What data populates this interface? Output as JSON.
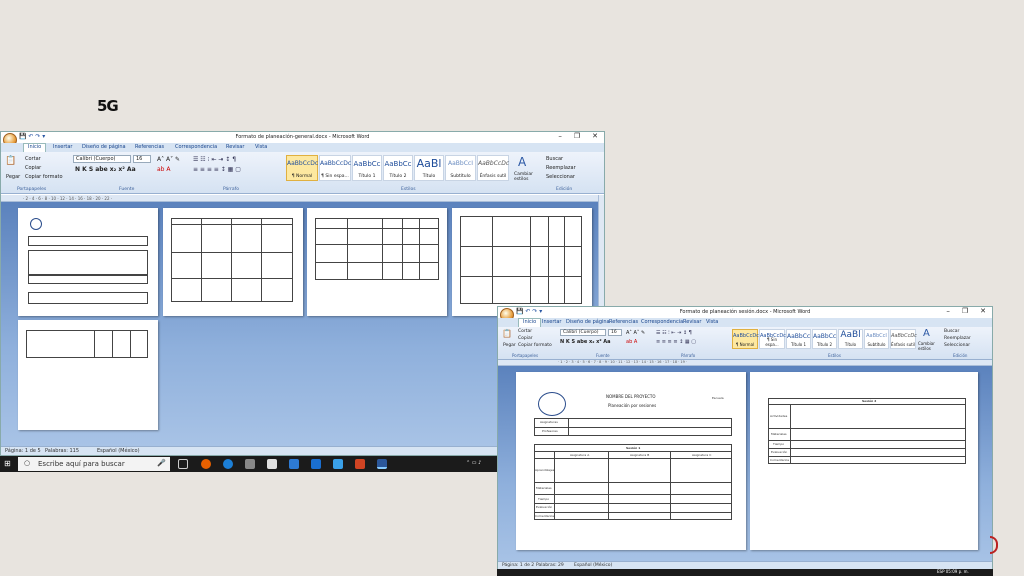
{
  "slide": {
    "title": "5G"
  },
  "window1": {
    "title": "Formato de planeación-general.docx - Microsoft Word",
    "tabs": [
      "Inicio",
      "Insertar",
      "Diseño de página",
      "Referencias",
      "Correspondencia",
      "Revisar",
      "Vista"
    ],
    "clipboard": {
      "paste": "Pegar",
      "cut": "Cortar",
      "copy": "Copiar",
      "format_painter": "Copiar formato",
      "group": "Portapapeles"
    },
    "font": {
      "name": "Calibri (Cuerpo)",
      "size": "16",
      "group": "Fuente"
    },
    "paragraph_group": "Párrafo",
    "styles": [
      {
        "sample": "AaBbCcDc",
        "name": "¶ Normal"
      },
      {
        "sample": "AaBbCcDc",
        "name": "¶ Sin espa..."
      },
      {
        "sample": "AaBbCc",
        "name": "Título 1"
      },
      {
        "sample": "AaBbCc",
        "name": "Título 2"
      },
      {
        "sample": "AaBl",
        "name": "Título"
      },
      {
        "sample": "AaBbCcI",
        "name": "Subtítulo"
      },
      {
        "sample": "AaBbCcDc",
        "name": "Énfasis sutil"
      }
    ],
    "styles_group": "Estilos",
    "change_styles": "Cambiar estilos",
    "editing": {
      "find": "Buscar",
      "replace": "Reemplazar",
      "select": "Seleccionar",
      "group": "Edición"
    },
    "status": {
      "page": "Página: 1 de 5",
      "words": "Palabras: 115",
      "language": "Español (México)"
    }
  },
  "taskbar1": {
    "search_placeholder": "Escribe aquí para buscar"
  },
  "window2": {
    "title": "Formato de planeación sesión.docx - Microsoft Word",
    "tabs": [
      "Inicio",
      "Insertar",
      "Diseño de página",
      "Referencias",
      "Correspondencia",
      "Revisar",
      "Vista"
    ],
    "clipboard": {
      "paste": "Pegar",
      "cut": "Cortar",
      "copy": "Copiar",
      "format_painter": "Copiar formato",
      "group": "Portapapeles"
    },
    "font": {
      "name": "Calibri (Cuerpo)",
      "size": "16",
      "group": "Fuente"
    },
    "paragraph_group": "Párrafo",
    "styles": [
      {
        "sample": "AaBbCcDc",
        "name": "¶ Normal"
      },
      {
        "sample": "AaBbCcDc",
        "name": "¶ Sin espa..."
      },
      {
        "sample": "AaBbCc",
        "name": "Título 1"
      },
      {
        "sample": "AaBbCc",
        "name": "Título 2"
      },
      {
        "sample": "AaBl",
        "name": "Título"
      },
      {
        "sample": "AaBbCcI",
        "name": "Subtítulo"
      },
      {
        "sample": "AaBbCcDc",
        "name": "Énfasis sutil"
      }
    ],
    "styles_group": "Estilos",
    "change_styles": "Cambiar estilos",
    "editing": {
      "find": "Buscar",
      "replace": "Reemplazar",
      "select": "Seleccionar",
      "group": "Edición"
    },
    "doc_page1": {
      "project": "NOMBRE DEL PROYECTO",
      "subtitle": "Planeación por sesiones",
      "corner": "Escuela",
      "rows": [
        "Asignaturas",
        "Profesores"
      ],
      "session": "Sesión 1",
      "subjects": [
        "Asignatura A",
        "Asignatura B",
        "Asignatura C"
      ],
      "row_labels": [
        "Aprendizajes",
        "Materiales",
        "Tiempo",
        "Evaluación",
        "Comentarios"
      ]
    },
    "doc_page2": {
      "session": "Sesión 2",
      "row_labels": [
        "Actividades",
        "Materiales",
        "Tiempo",
        "Evaluación",
        "Comentarios"
      ]
    },
    "status": {
      "page": "Página: 1 de 2",
      "words": "Palabras: 29",
      "language": "Español (México)"
    }
  },
  "tray": {
    "lang": "ESP",
    "time": "05:09 p. m."
  }
}
